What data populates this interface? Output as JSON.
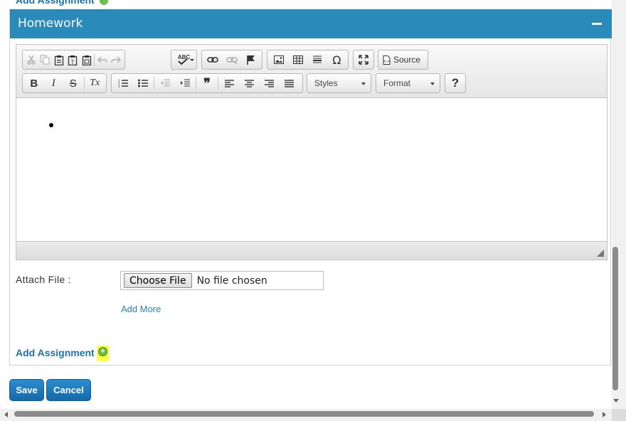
{
  "top_partial_link": "Add Assignment",
  "panel": {
    "title": "Homework"
  },
  "toolbar": {
    "source_label": "Source",
    "styles_label": "Styles",
    "format_label": "Format",
    "help_label": "?",
    "spell_label": "ABC",
    "omega_label": "Ω",
    "bold_label": "B",
    "italic_label": "I",
    "strike_label": "S",
    "removeformat_label": "Tx",
    "blockquote_label": "❞"
  },
  "attach": {
    "label": "Attach File :",
    "choose_button": "Choose File",
    "status": "No file chosen",
    "add_more": "Add More"
  },
  "add_assignment_label": "Add Assignment",
  "buttons": {
    "save": "Save",
    "cancel": "Cancel"
  },
  "colors": {
    "header": "#2a8ab9",
    "link": "#1e73ad",
    "button": "#1a77bb",
    "highlight": "#ffff44",
    "add_icon": "#6cbf3f"
  }
}
